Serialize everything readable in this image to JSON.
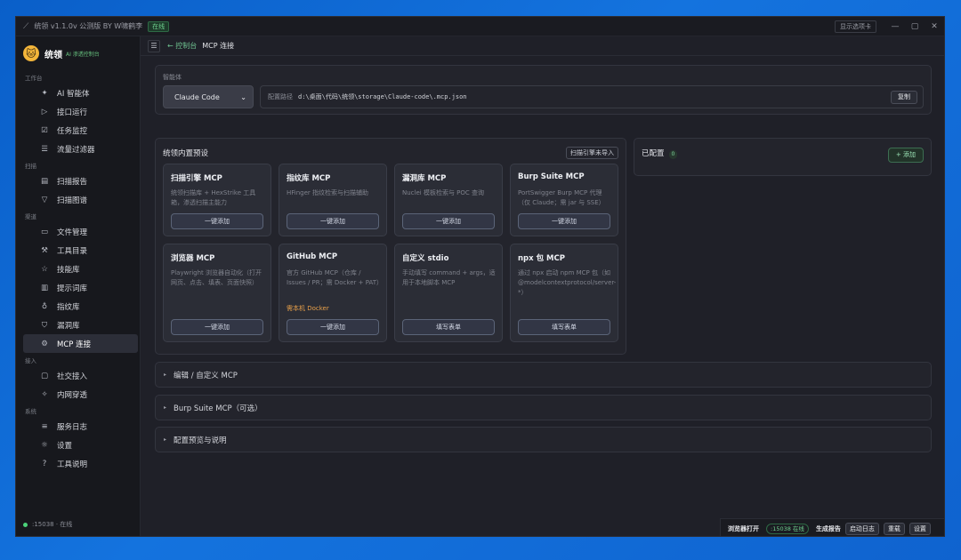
{
  "titlebar": {
    "title": "统领 v1.1.0v 公测版 BY W啸鹤李",
    "status": "在线",
    "show_tabs": "显示选项卡",
    "minimize": "—",
    "maximize": "▢",
    "close": "✕"
  },
  "brand": {
    "name": "统领",
    "tag": "AI 渗透控制台"
  },
  "sidebar": {
    "sections": [
      {
        "title": "工作台",
        "items": [
          {
            "label": "AI 智能体",
            "icon": "sparkle-icon"
          },
          {
            "label": "接口运行",
            "icon": "play-icon"
          },
          {
            "label": "任务监控",
            "icon": "task-icon"
          },
          {
            "label": "流量过滤器",
            "icon": "filter-lines-icon"
          }
        ]
      },
      {
        "title": "扫描",
        "items": [
          {
            "label": "扫描报告",
            "icon": "report-icon"
          },
          {
            "label": "扫描图谱",
            "icon": "funnel-icon"
          }
        ]
      },
      {
        "title": "渠道",
        "items": [
          {
            "label": "文件管理",
            "icon": "folder-icon"
          },
          {
            "label": "工具目录",
            "icon": "wrench-icon"
          },
          {
            "label": "技能库",
            "icon": "star-icon"
          },
          {
            "label": "提示词库",
            "icon": "book-icon"
          },
          {
            "label": "指纹库",
            "icon": "bulb-icon"
          },
          {
            "label": "漏洞库",
            "icon": "shield-icon"
          },
          {
            "label": "MCP 连接",
            "icon": "gear-icon"
          }
        ]
      },
      {
        "title": "接入",
        "items": [
          {
            "label": "社交接入",
            "icon": "chat-icon"
          },
          {
            "label": "内网穿透",
            "icon": "tunnel-icon"
          }
        ]
      },
      {
        "title": "系统",
        "items": [
          {
            "label": "服务日志",
            "icon": "list-icon"
          },
          {
            "label": "设置",
            "icon": "settings-icon"
          },
          {
            "label": "工具说明",
            "icon": "help-icon"
          }
        ]
      }
    ],
    "status": ":15038 · 在线"
  },
  "topbar": {
    "menu": "☰",
    "back": "← 控制台",
    "current": "MCP 连接"
  },
  "agent": {
    "label": "智能体",
    "selected": "Claude Code",
    "path_label": "配置路径",
    "path_value": "d:\\桌面\\代码\\统领\\storage\\Claude-code\\.mcp.json",
    "copy": "复制"
  },
  "presets": {
    "title": "统领内置预设",
    "tag": "扫描引擎未导入",
    "cards": [
      {
        "title": "扫描引擎 MCP",
        "desc": "统领扫描库 + HexStrike 工具箱，渗透扫描主能力",
        "warn": "",
        "button": "一键添加"
      },
      {
        "title": "指纹库 MCP",
        "desc": "HFinger 指纹检索与扫描辅助",
        "warn": "",
        "button": "一键添加"
      },
      {
        "title": "漏洞库 MCP",
        "desc": "Nuclei 模板检索与 POC 查询",
        "warn": "",
        "button": "一键添加"
      },
      {
        "title": "Burp Suite MCP",
        "desc": "PortSwigger Burp MCP 代理（仅 Claude；需 jar 与 SSE）",
        "warn": "",
        "button": "一键添加"
      },
      {
        "title": "浏览器 MCP",
        "desc": "Playwright 浏览器自动化（打开网页、点击、填表、页面快照）",
        "warn": "",
        "button": "一键添加"
      },
      {
        "title": "GitHub MCP",
        "desc": "官方 GitHub MCP（仓库 / Issues / PR；需 Docker + PAT）",
        "warn": "需本机 Docker",
        "button": "一键添加"
      },
      {
        "title": "自定义 stdio",
        "desc": "手动填写 command + args，适用于本地脚本 MCP",
        "warn": "",
        "button": "填写表单"
      },
      {
        "title": "npx 包 MCP",
        "desc": "通过 npx 启动 npm MCP 包（如 @modelcontextprotocol/server-*）",
        "warn": "",
        "button": "填写表单"
      }
    ]
  },
  "configured": {
    "title": "已配置",
    "count": "0",
    "add": "+ 添加"
  },
  "accordions": [
    "编辑 / 自定义 MCP",
    "Burp Suite MCP（可选）",
    "配置预览与说明"
  ],
  "bottombar": {
    "browser": "浏览器打开",
    "port": ":15038 在线",
    "report": "生成报告",
    "log": "启动日志",
    "reload": "重载",
    "settings": "设置"
  }
}
